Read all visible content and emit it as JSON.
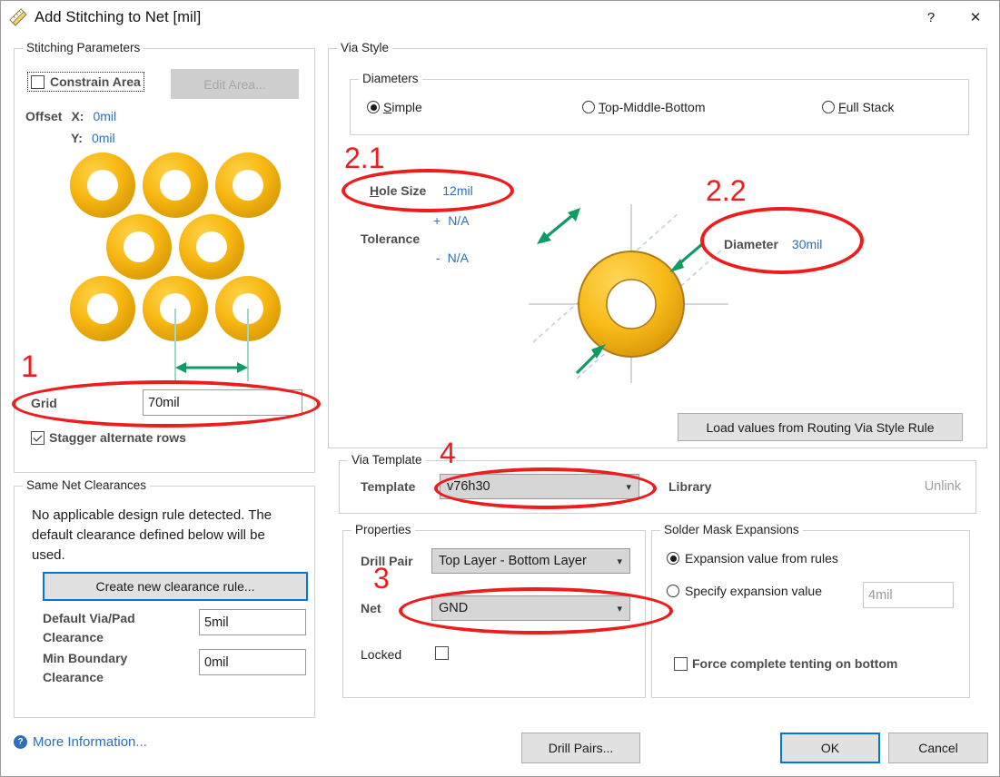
{
  "window": {
    "title": "Add Stitching to Net [mil]",
    "icon": "ruler-triangle-icon",
    "help_button": "?",
    "close_button": "✕"
  },
  "stitching_parameters": {
    "legend": "Stitching Parameters",
    "constrain_area": {
      "label": "Constrain Area",
      "checked": false
    },
    "edit_area_button": {
      "label": "Edit Area...",
      "enabled": false
    },
    "offset": {
      "label": "Offset",
      "x_label": "X:",
      "x_value": "0mil",
      "y_label": "Y:",
      "y_value": "0mil"
    },
    "grid": {
      "label": "Grid",
      "value": "70mil"
    },
    "stagger": {
      "label": "Stagger alternate rows",
      "checked": true
    }
  },
  "same_net_clearances": {
    "legend": "Same Net Clearances",
    "message": "No applicable design rule detected. The default clearance defined below will be used.",
    "create_rule_button": "Create new clearance rule...",
    "default_via_pad_label": "Default Via/Pad Clearance",
    "default_via_pad_value": "5mil",
    "min_boundary_label": "Min Boundary Clearance",
    "min_boundary_value": "0mil"
  },
  "via_style": {
    "legend": "Via Style",
    "diameters": {
      "legend": "Diameters",
      "options": [
        {
          "label": "Simple",
          "selected": true
        },
        {
          "label": "Top-Middle-Bottom",
          "selected": false
        },
        {
          "label": "Full Stack",
          "selected": false
        }
      ]
    },
    "hole_size": {
      "label": "Hole Size",
      "value": "12mil"
    },
    "tolerance": {
      "label": "Tolerance",
      "plus_sign": "+",
      "plus_value": "N/A",
      "minus_sign": "-",
      "minus_value": "N/A"
    },
    "diameter": {
      "label": "Diameter",
      "value": "30mil"
    },
    "load_values_button": "Load values from Routing Via Style Rule"
  },
  "via_template": {
    "legend": "Via Template",
    "template_label": "Template",
    "template_value": "v76h30",
    "library_label": "Library",
    "unlink_label": "Unlink"
  },
  "properties": {
    "legend": "Properties",
    "drill_pair_label": "Drill Pair",
    "drill_pair_value": "Top Layer - Bottom Layer",
    "net_label": "Net",
    "net_value": "GND",
    "locked_label": "Locked",
    "locked_checked": false
  },
  "solder_mask": {
    "legend": "Solder Mask Expansions",
    "from_rules": {
      "label": "Expansion value from rules",
      "selected": true
    },
    "specify": {
      "label": "Specify expansion value",
      "selected": false
    },
    "specify_value": "4mil",
    "force_tenting": {
      "label": "Force complete tenting on bottom",
      "checked": false
    }
  },
  "footer": {
    "more_information": "More Information...",
    "drill_pairs_button": "Drill Pairs...",
    "ok_button": "OK",
    "cancel_button": "Cancel"
  },
  "annotations": [
    {
      "id": "1",
      "text": "1"
    },
    {
      "id": "2.1",
      "text": "2.1"
    },
    {
      "id": "2.2",
      "text": "2.2"
    },
    {
      "id": "3",
      "text": "3"
    },
    {
      "id": "4",
      "text": "4"
    }
  ],
  "colors": {
    "accent_blue": "#0078d7",
    "value_blue": "#2d6fbb",
    "annotation_red": "#ee1c1c",
    "via_gold": "#f5b614",
    "arrow_green": "#0f9b64"
  }
}
